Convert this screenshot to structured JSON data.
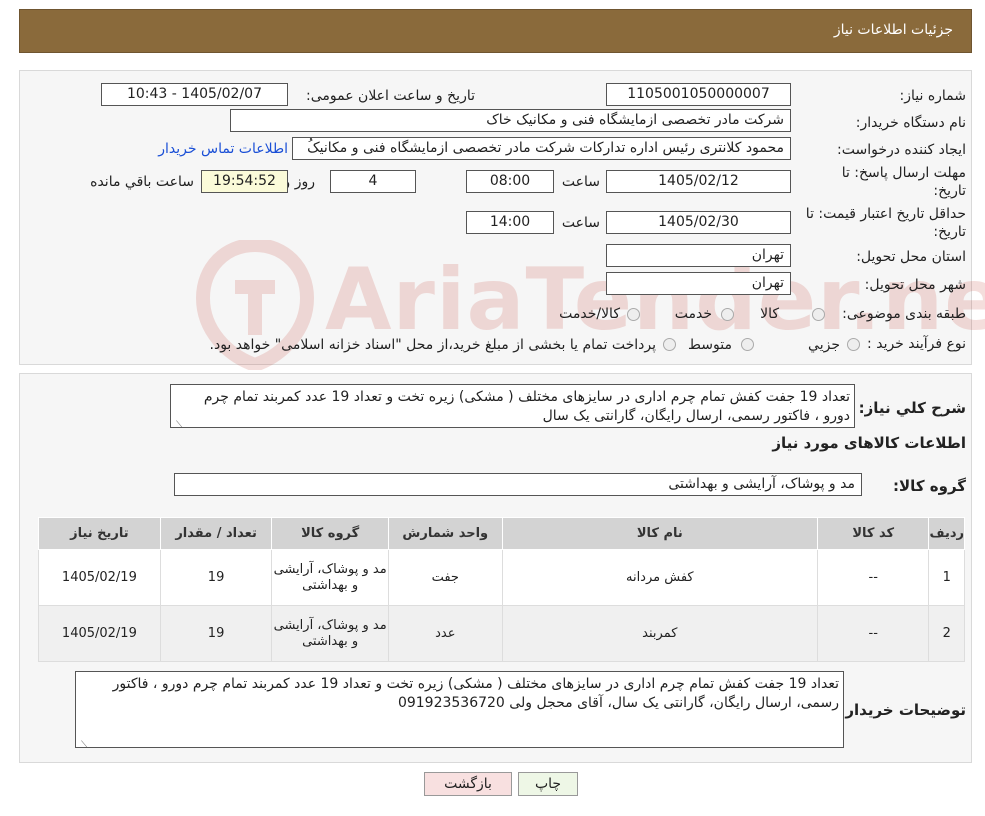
{
  "header": {
    "title": "جزئیات اطلاعات نیاز"
  },
  "form": {
    "need_number_label": "شماره نیاز:",
    "need_number": "1105001050000007",
    "announce_label": "تاریخ و ساعت اعلان عمومی:",
    "announce_value": "1405/02/07 - 10:43",
    "buyer_org_label": "نام دستگاه خریدار:",
    "buyer_org": "شرکت مادر تخصصی ازمایشگاه فنی و مکانیک خاک",
    "requester_label": "ایجاد کننده درخواست:",
    "requester": "محمود کلانتری رئیس اداره تدارکات شرکت مادر تخصصی ازمایشگاه فنی و مکانیکُ",
    "contact_link": "اطلاعات تماس خریدار",
    "deadline_label_1": "مهلت ارسال پاسخ: تا",
    "deadline_label_2": "تاریخ:",
    "deadline_date": "1405/02/12",
    "time_label": "ساعت",
    "deadline_time": "08:00",
    "days_value": "4",
    "days_label": "روز و",
    "remaining_time": "19:54:52",
    "remaining_label": "ساعت باقي مانده",
    "validity_label_1": "حداقل تاریخ اعتبار قیمت: تا",
    "validity_label_2": "تاریخ:",
    "validity_date": "1405/02/30",
    "validity_time": "14:00",
    "province_label": "استان محل تحویل:",
    "province": "تهران",
    "city_label": "شهر محل تحویل:",
    "city": "تهران",
    "category_label": "طبقه بندی موضوعی:",
    "category_options": [
      "کالا",
      "خدمت",
      "کالا/خدمت"
    ],
    "process_label": "نوع فرآیند خرید :",
    "process_options": [
      "جزیي",
      "متوسط"
    ],
    "process_note": "پرداخت تمام یا بخشی از مبلغ خرید،از محل \"اسناد خزانه اسلامی\" خواهد بود."
  },
  "description": {
    "label": "شرح كلي نياز:",
    "text": "تعداد 19 جفت کفش تمام چرم اداری در سایزهای مختلف ( مشکی) زیره تخت و تعداد 19 عدد کمربند تمام چرم دورو ، فاکتور رسمی، ارسال رایگان، گارانتی یک سال"
  },
  "goods": {
    "section_title": "اطلاعات کالاهای مورد نیاز",
    "group_label": "گروه کالا:",
    "group_value": "مد و پوشاک، آرایشی و بهداشتی",
    "columns": [
      "ردیف",
      "کد کالا",
      "نام کالا",
      "واحد شمارش",
      "گروه کالا",
      "تعداد / مقدار",
      "تاریخ نیاز"
    ],
    "rows": [
      {
        "row": "1",
        "code": "--",
        "name": "کفش مردانه",
        "unit": "جفت",
        "group": "مد و پوشاک، آرایشی و بهداشتی",
        "qty": "19",
        "date": "1405/02/19"
      },
      {
        "row": "2",
        "code": "--",
        "name": "کمربند",
        "unit": "عدد",
        "group": "مد و پوشاک، آرایشی و بهداشتی",
        "qty": "19",
        "date": "1405/02/19"
      }
    ]
  },
  "buyer_notes": {
    "label": "توضیحات خریدار:",
    "text": "تعداد 19 جفت کفش تمام چرم اداری در سایزهای مختلف ( مشکی) زیره تخت و تعداد 19 عدد کمربند تمام چرم دورو ، فاکتور رسمی، ارسال رایگان، گارانتی یک سال، آقای محجل ولی 091923536720"
  },
  "buttons": {
    "print": "چاپ",
    "back": "بازگشت"
  },
  "watermark": {
    "text": "AriaTender.neT"
  },
  "colors": {
    "header_bg": "#8a6a3b",
    "link": "#1a4fd6",
    "time_box": "#fbfbd9",
    "back_button": "#f8e0e0",
    "print_button": "#eef7e6"
  }
}
